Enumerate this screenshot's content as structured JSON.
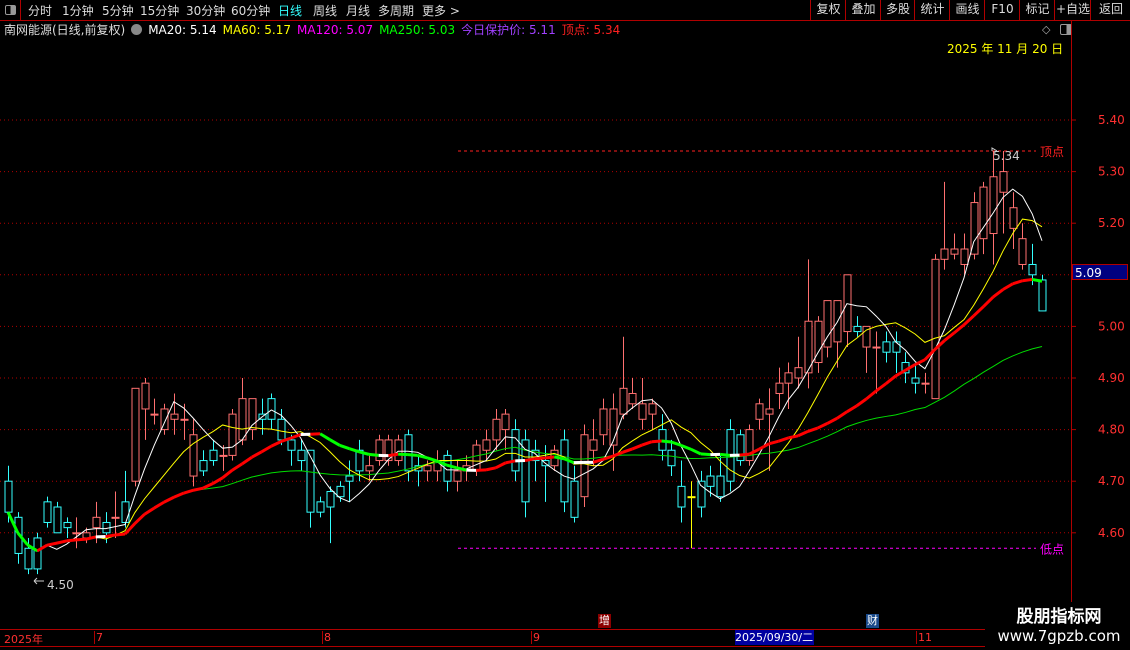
{
  "toolbar": {
    "periods": [
      "分时",
      "1分钟",
      "5分钟",
      "15分钟",
      "30分钟",
      "60分钟",
      "日线",
      "周线",
      "月线",
      "多周期",
      "更多 >"
    ],
    "active_period": "日线",
    "right_buttons": [
      "复权",
      "叠加",
      "多股",
      "统计",
      "画线",
      "F10",
      "标记",
      "+自选",
      "返回"
    ]
  },
  "info": {
    "title": "南网能源(日线,前复权)",
    "ma20": "MA20: 5.14",
    "ma60": "MA60: 5.17",
    "ma120": "MA120: 5.07",
    "ma250": "MA250: 5.03",
    "protect": "今日保护价: 5.11",
    "top": "顶点: 5.34"
  },
  "date_label": "2025 年 11 月 20 日",
  "current_price": "5.09",
  "markers": {
    "top_label": "顶点",
    "low_label": "低点",
    "high_value": "5.34",
    "low_value": "4.50"
  },
  "x_axis": {
    "labels": [
      "2025年",
      "7",
      "8",
      "9",
      "11"
    ],
    "selected_date": "2025/09/30/二",
    "badges": [
      "增",
      "财"
    ]
  },
  "watermark": {
    "line1": "股朋指标网",
    "line2": "www.7gpzb.com"
  },
  "colors": {
    "up": "#ff7070",
    "down": "#33ffff",
    "ma_fast": "#ffffff",
    "ma_mid": "#ffff00",
    "ma_thick_up": "#ff0000",
    "ma_thick_down": "#00ff00",
    "ma_slow": "#00dd00",
    "grid": "#b00000"
  },
  "chart_data": {
    "type": "candlestick",
    "y_ticks": [
      5.4,
      5.3,
      5.2,
      5.1,
      5.0,
      4.9,
      4.8,
      4.7,
      4.6
    ],
    "y_tick_labels": [
      "5.40",
      "5.30",
      "5.20",
      "5.10",
      "5.00",
      "4.90",
      "4.80",
      "4.70",
      "4.60"
    ],
    "ylim": [
      4.47,
      5.54
    ],
    "top_line": 5.34,
    "low_line": 4.57,
    "ohlc": [
      [
        4.7,
        4.73,
        4.62,
        4.64
      ],
      [
        4.63,
        4.64,
        4.54,
        4.56
      ],
      [
        4.57,
        4.59,
        4.52,
        4.53
      ],
      [
        4.59,
        4.6,
        4.52,
        4.53
      ],
      [
        4.66,
        4.67,
        4.61,
        4.62
      ],
      [
        4.65,
        4.66,
        4.6,
        4.6
      ],
      [
        4.62,
        4.63,
        4.59,
        4.61
      ],
      [
        4.6,
        4.63,
        4.57,
        4.6
      ],
      [
        4.59,
        4.61,
        4.58,
        4.6
      ],
      [
        4.61,
        4.66,
        4.58,
        4.63
      ],
      [
        4.62,
        4.64,
        4.58,
        4.6
      ],
      [
        4.63,
        4.68,
        4.59,
        4.63
      ],
      [
        4.66,
        4.72,
        4.61,
        4.62
      ],
      [
        4.7,
        4.88,
        4.69,
        4.88
      ],
      [
        4.84,
        4.9,
        4.78,
        4.89
      ],
      [
        4.83,
        4.86,
        4.81,
        4.83
      ],
      [
        4.8,
        4.85,
        4.79,
        4.84
      ],
      [
        4.82,
        4.87,
        4.79,
        4.83
      ],
      [
        4.82,
        4.85,
        4.78,
        4.82
      ],
      [
        4.71,
        4.82,
        4.69,
        4.79
      ],
      [
        4.74,
        4.76,
        4.71,
        4.72
      ],
      [
        4.76,
        4.78,
        4.73,
        4.74
      ],
      [
        4.75,
        4.77,
        4.72,
        4.75
      ],
      [
        4.75,
        4.84,
        4.74,
        4.83
      ],
      [
        4.78,
        4.9,
        4.77,
        4.86
      ],
      [
        4.8,
        4.85,
        4.78,
        4.86
      ],
      [
        4.83,
        4.86,
        4.79,
        4.82
      ],
      [
        4.86,
        4.87,
        4.8,
        4.82
      ],
      [
        4.82,
        4.84,
        4.77,
        4.78
      ],
      [
        4.78,
        4.79,
        4.73,
        4.76
      ],
      [
        4.76,
        4.78,
        4.72,
        4.74
      ],
      [
        4.76,
        4.76,
        4.61,
        4.64
      ],
      [
        4.66,
        4.67,
        4.63,
        4.64
      ],
      [
        4.68,
        4.69,
        4.58,
        4.65
      ],
      [
        4.69,
        4.7,
        4.66,
        4.67
      ],
      [
        4.71,
        4.74,
        4.66,
        4.7
      ],
      [
        4.76,
        4.78,
        4.7,
        4.72
      ],
      [
        4.72,
        4.75,
        4.7,
        4.73
      ],
      [
        4.74,
        4.79,
        4.73,
        4.78
      ],
      [
        4.74,
        4.79,
        4.73,
        4.78
      ],
      [
        4.74,
        4.79,
        4.73,
        4.78
      ],
      [
        4.79,
        4.8,
        4.7,
        4.72
      ],
      [
        4.73,
        4.75,
        4.69,
        4.72
      ],
      [
        4.72,
        4.74,
        4.7,
        4.73
      ],
      [
        4.72,
        4.76,
        4.7,
        4.74
      ],
      [
        4.75,
        4.76,
        4.68,
        4.7
      ],
      [
        4.7,
        4.74,
        4.68,
        4.72
      ],
      [
        4.72,
        4.75,
        4.7,
        4.73
      ],
      [
        4.72,
        4.78,
        4.71,
        4.77
      ],
      [
        4.76,
        4.8,
        4.74,
        4.78
      ],
      [
        4.78,
        4.84,
        4.76,
        4.82
      ],
      [
        4.8,
        4.84,
        4.76,
        4.83
      ],
      [
        4.8,
        4.82,
        4.7,
        4.72
      ],
      [
        4.78,
        4.8,
        4.63,
        4.66
      ],
      [
        4.76,
        4.78,
        4.7,
        4.74
      ],
      [
        4.74,
        4.77,
        4.66,
        4.73
      ],
      [
        4.73,
        4.77,
        4.72,
        4.76
      ],
      [
        4.78,
        4.8,
        4.64,
        4.66
      ],
      [
        4.7,
        4.73,
        4.62,
        4.63
      ],
      [
        4.67,
        4.81,
        4.65,
        4.79
      ],
      [
        4.76,
        4.82,
        4.73,
        4.78
      ],
      [
        4.79,
        4.86,
        4.77,
        4.84
      ],
      [
        4.77,
        4.87,
        4.72,
        4.84
      ],
      [
        4.83,
        4.98,
        4.82,
        4.88
      ],
      [
        4.85,
        4.9,
        4.84,
        4.87
      ],
      [
        4.82,
        4.9,
        4.8,
        4.85
      ],
      [
        4.83,
        4.86,
        4.8,
        4.85
      ],
      [
        4.8,
        4.83,
        4.74,
        4.76
      ],
      [
        4.76,
        4.78,
        4.71,
        4.73
      ],
      [
        4.69,
        4.74,
        4.62,
        4.65
      ],
      [
        4.67,
        4.7,
        4.57,
        4.67
      ],
      [
        4.7,
        4.72,
        4.63,
        4.65
      ],
      [
        4.71,
        4.73,
        4.67,
        4.69
      ],
      [
        4.71,
        4.75,
        4.66,
        4.67
      ],
      [
        4.8,
        4.82,
        4.68,
        4.7
      ],
      [
        4.79,
        4.8,
        4.73,
        4.74
      ],
      [
        4.74,
        4.81,
        4.73,
        4.8
      ],
      [
        4.82,
        4.86,
        4.8,
        4.85
      ],
      [
        4.83,
        4.88,
        4.72,
        4.84
      ],
      [
        4.87,
        4.92,
        4.84,
        4.89
      ],
      [
        4.89,
        4.93,
        4.84,
        4.91
      ],
      [
        4.9,
        4.98,
        4.88,
        4.92
      ],
      [
        4.91,
        5.13,
        4.88,
        5.01
      ],
      [
        4.93,
        5.02,
        4.91,
        5.01
      ],
      [
        4.96,
        5.05,
        4.94,
        5.05
      ],
      [
        4.97,
        5.05,
        4.92,
        5.05
      ],
      [
        4.99,
        5.1,
        4.96,
        5.1
      ],
      [
        5.0,
        5.02,
        4.98,
        4.99
      ],
      [
        4.96,
        5.0,
        4.91,
        5.0
      ],
      [
        4.96,
        4.99,
        4.87,
        4.96
      ],
      [
        4.97,
        4.99,
        4.93,
        4.95
      ],
      [
        4.97,
        4.99,
        4.91,
        4.95
      ],
      [
        4.93,
        4.95,
        4.89,
        4.91
      ],
      [
        4.9,
        4.93,
        4.87,
        4.89
      ],
      [
        4.89,
        4.91,
        4.87,
        4.89
      ],
      [
        4.86,
        5.14,
        4.86,
        5.13
      ],
      [
        5.13,
        5.28,
        5.11,
        5.15
      ],
      [
        5.14,
        5.18,
        5.13,
        5.15
      ],
      [
        5.12,
        5.18,
        5.1,
        5.15
      ],
      [
        5.14,
        5.26,
        5.13,
        5.24
      ],
      [
        5.17,
        5.28,
        5.14,
        5.27
      ],
      [
        5.18,
        5.34,
        5.12,
        5.29
      ],
      [
        5.26,
        5.34,
        5.18,
        5.3
      ],
      [
        5.19,
        5.26,
        5.15,
        5.23
      ],
      [
        5.12,
        5.2,
        5.11,
        5.17
      ],
      [
        5.12,
        5.16,
        5.08,
        5.1
      ],
      [
        5.09,
        5.1,
        5.03,
        5.03
      ]
    ],
    "ma_windows": [
      5,
      10,
      20,
      40
    ]
  }
}
